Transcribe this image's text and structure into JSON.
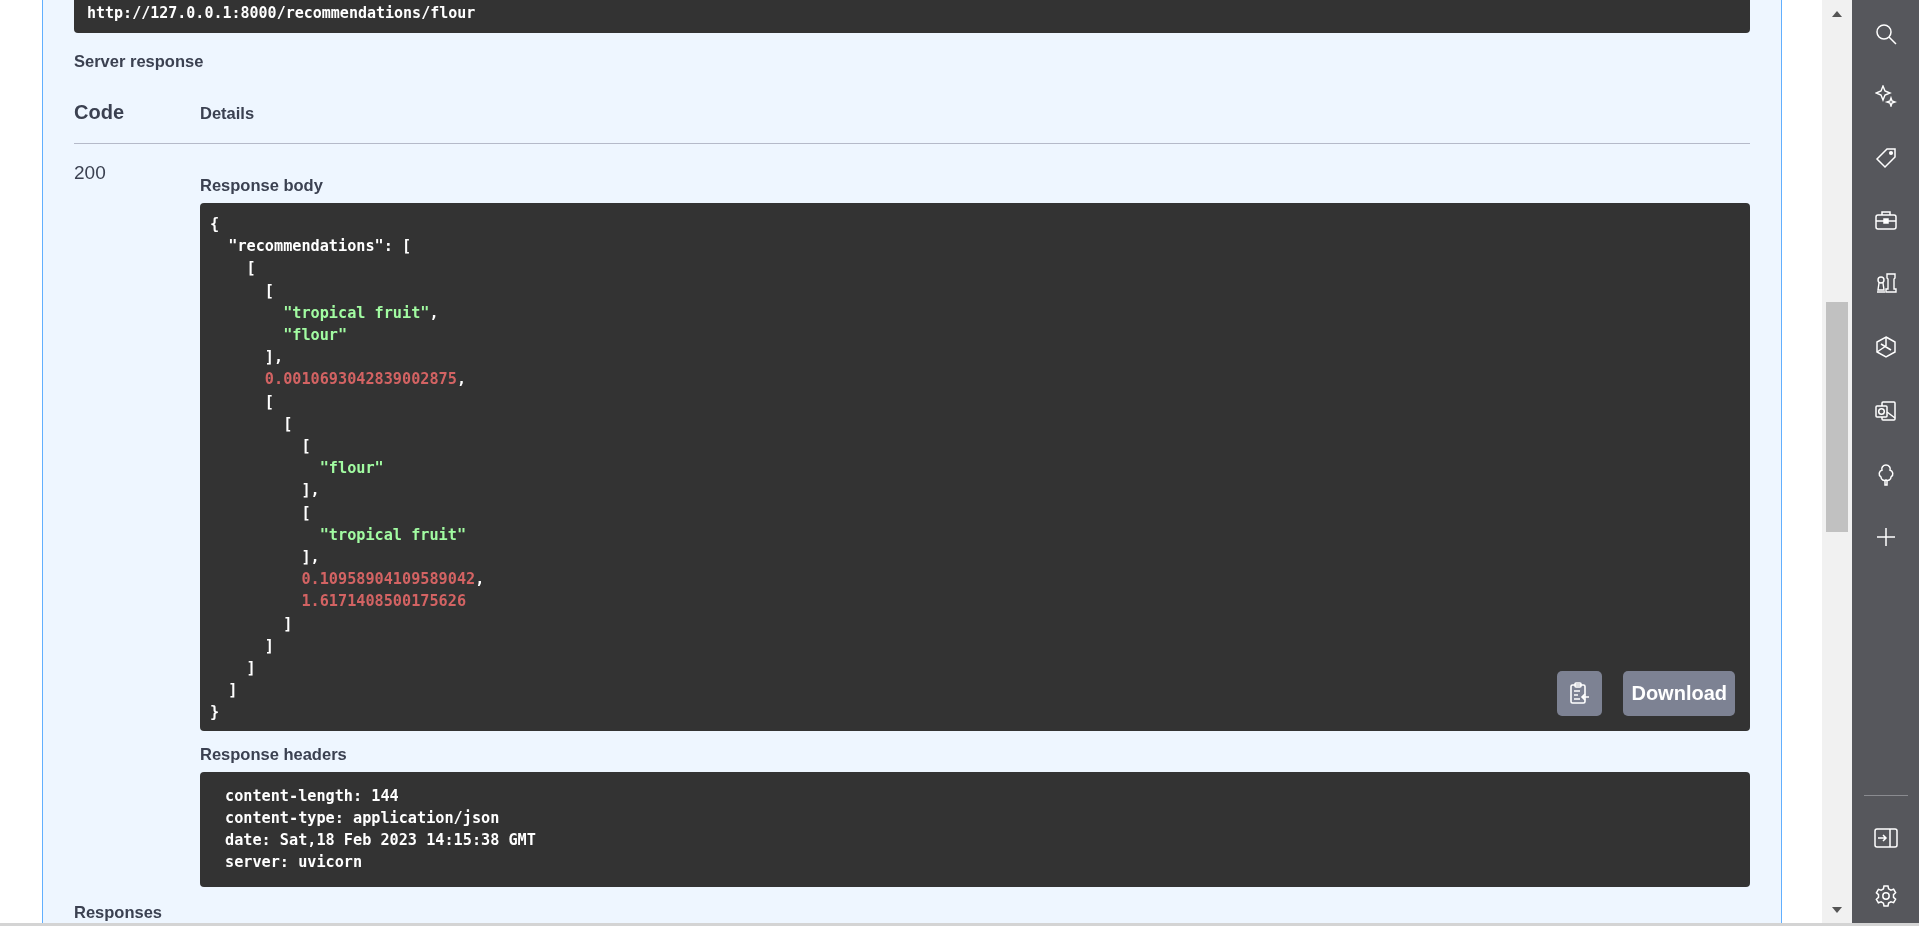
{
  "request_url": "http://127.0.0.1:8000/recommendations/flour",
  "server_response": {
    "title": "Server response",
    "columns": [
      "Code",
      "Details"
    ],
    "code": "200",
    "response_body": {
      "label": "Response body",
      "lines": [
        [
          {
            "kind": "punct",
            "text": "{"
          }
        ],
        [
          {
            "kind": "punct",
            "text": "  \"recommendations\": ["
          }
        ],
        [
          {
            "kind": "punct",
            "text": "    ["
          }
        ],
        [
          {
            "kind": "punct",
            "text": "      ["
          }
        ],
        [
          {
            "kind": "string",
            "text": "        \"tropical fruit\""
          },
          {
            "kind": "punct",
            "text": ","
          }
        ],
        [
          {
            "kind": "string",
            "text": "        \"flour\""
          }
        ],
        [
          {
            "kind": "punct",
            "text": "      ],"
          }
        ],
        [
          {
            "kind": "number",
            "text": "      0.0010693042839002875"
          },
          {
            "kind": "punct",
            "text": ","
          }
        ],
        [
          {
            "kind": "punct",
            "text": "      ["
          }
        ],
        [
          {
            "kind": "punct",
            "text": "        ["
          }
        ],
        [
          {
            "kind": "punct",
            "text": "          ["
          }
        ],
        [
          {
            "kind": "string",
            "text": "            \"flour\""
          }
        ],
        [
          {
            "kind": "punct",
            "text": "          ],"
          }
        ],
        [
          {
            "kind": "punct",
            "text": "          ["
          }
        ],
        [
          {
            "kind": "string",
            "text": "            \"tropical fruit\""
          }
        ],
        [
          {
            "kind": "punct",
            "text": "          ],"
          }
        ],
        [
          {
            "kind": "number",
            "text": "          0.10958904109589042"
          },
          {
            "kind": "punct",
            "text": ","
          }
        ],
        [
          {
            "kind": "number",
            "text": "          1.6171408500175626"
          }
        ],
        [
          {
            "kind": "punct",
            "text": "        ]"
          }
        ],
        [
          {
            "kind": "punct",
            "text": "      ]"
          }
        ],
        [
          {
            "kind": "punct",
            "text": "    ]"
          }
        ],
        [
          {
            "kind": "punct",
            "text": "  ]"
          }
        ],
        [
          {
            "kind": "punct",
            "text": "}"
          }
        ]
      ],
      "download_button": "Download"
    },
    "response_headers": {
      "label": "Response headers",
      "lines": [
        "content-length: 144",
        "content-type: application/json",
        "date: Sat,18 Feb 2023 14:15:38 GMT",
        "server: uvicorn"
      ]
    }
  },
  "responses_title": "Responses"
}
